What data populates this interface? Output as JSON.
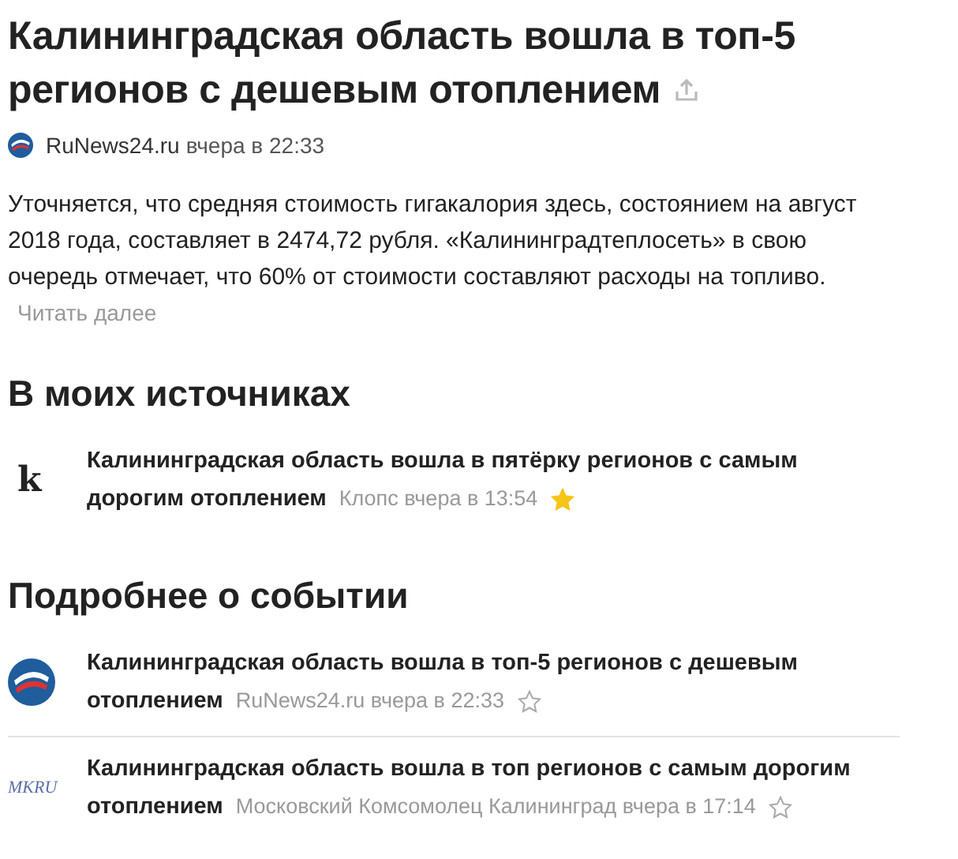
{
  "article": {
    "title_lines": [
      "Калининградская область вошла в топ-5",
      "регионов с дешевым отоплением"
    ],
    "source": {
      "logo": {
        "kind": "globe"
      },
      "name": "RuNews24.ru",
      "time": "вчера в 22:33"
    },
    "text": "Уточняется, что средняя стоимость гигакалория здесь, состоянием на август 2018 года, составляет в 2474,72 рубля. «Калининградтеплосеть» в свою очередь отмечает, что 60% от стоимости составляют расходы на топливо.",
    "read_more": "Читать далее"
  },
  "sections": [
    {
      "title": "В моих источниках",
      "items": [
        {
          "logo": {
            "kind": "letter",
            "text": "k"
          },
          "title_lines": [
            "Калининградская область вошла в пятёрку регионов с самым",
            "дорогим отоплением"
          ],
          "meta": "Клопс вчера в 13:54",
          "starred": true
        }
      ]
    },
    {
      "title": "Подробнее о событии",
      "items": [
        {
          "logo": {
            "kind": "globe"
          },
          "title_lines": [
            "Калининградская область вошла в топ-5 регионов с дешевым",
            "отоплением"
          ],
          "meta": "RuNews24.ru вчера в 22:33",
          "starred": false
        },
        {
          "logo": {
            "kind": "wordmark",
            "text": "MKRU"
          },
          "title_lines": [
            "Калининградская область вошла в топ регионов с самым дорогим",
            "отоплением"
          ],
          "meta": "Московский Комсомолец Калининград вчера в 17:14",
          "starred": false
        }
      ]
    }
  ]
}
